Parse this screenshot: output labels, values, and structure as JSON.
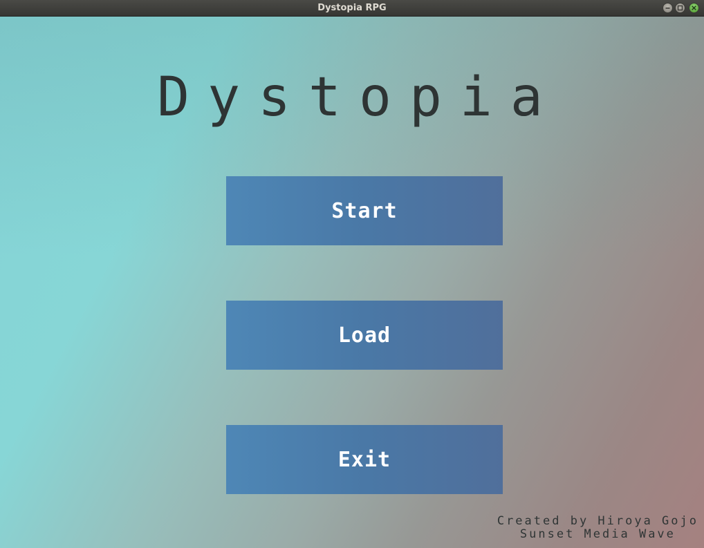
{
  "window": {
    "title": "Dystopia RPG",
    "controls": [
      "minimize-icon",
      "maximize-icon",
      "close-icon"
    ]
  },
  "game": {
    "title": "Dystopia",
    "menu": {
      "start_label": "Start",
      "load_label": "Load",
      "exit_label": "Exit"
    },
    "credits": {
      "line1": "Created by Hiroya Gojo",
      "line2": "Sunset Media Wave"
    }
  },
  "colors": {
    "button": "#4a7aa8",
    "button_text": "#ffffff",
    "title_text": "#2e3434",
    "background_left": "#87d6d6",
    "background_right": "#a58180"
  }
}
